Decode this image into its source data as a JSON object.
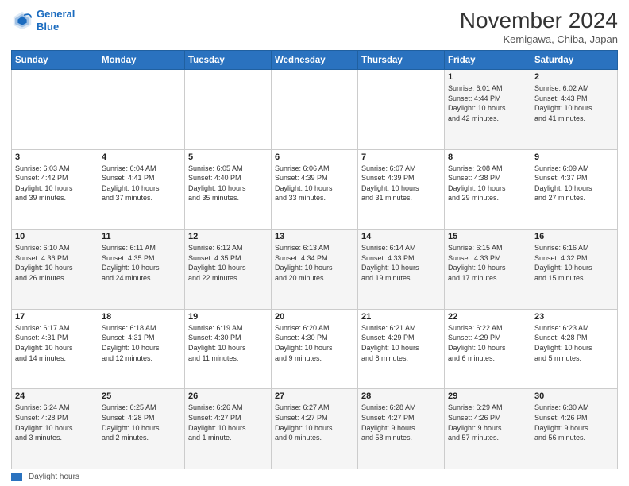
{
  "header": {
    "logo_line1": "General",
    "logo_line2": "Blue",
    "month_title": "November 2024",
    "location": "Kemigawa, Chiba, Japan"
  },
  "days_of_week": [
    "Sunday",
    "Monday",
    "Tuesday",
    "Wednesday",
    "Thursday",
    "Friday",
    "Saturday"
  ],
  "weeks": [
    [
      {
        "day": "",
        "info": ""
      },
      {
        "day": "",
        "info": ""
      },
      {
        "day": "",
        "info": ""
      },
      {
        "day": "",
        "info": ""
      },
      {
        "day": "",
        "info": ""
      },
      {
        "day": "1",
        "info": "Sunrise: 6:01 AM\nSunset: 4:44 PM\nDaylight: 10 hours\nand 42 minutes."
      },
      {
        "day": "2",
        "info": "Sunrise: 6:02 AM\nSunset: 4:43 PM\nDaylight: 10 hours\nand 41 minutes."
      }
    ],
    [
      {
        "day": "3",
        "info": "Sunrise: 6:03 AM\nSunset: 4:42 PM\nDaylight: 10 hours\nand 39 minutes."
      },
      {
        "day": "4",
        "info": "Sunrise: 6:04 AM\nSunset: 4:41 PM\nDaylight: 10 hours\nand 37 minutes."
      },
      {
        "day": "5",
        "info": "Sunrise: 6:05 AM\nSunset: 4:40 PM\nDaylight: 10 hours\nand 35 minutes."
      },
      {
        "day": "6",
        "info": "Sunrise: 6:06 AM\nSunset: 4:39 PM\nDaylight: 10 hours\nand 33 minutes."
      },
      {
        "day": "7",
        "info": "Sunrise: 6:07 AM\nSunset: 4:39 PM\nDaylight: 10 hours\nand 31 minutes."
      },
      {
        "day": "8",
        "info": "Sunrise: 6:08 AM\nSunset: 4:38 PM\nDaylight: 10 hours\nand 29 minutes."
      },
      {
        "day": "9",
        "info": "Sunrise: 6:09 AM\nSunset: 4:37 PM\nDaylight: 10 hours\nand 27 minutes."
      }
    ],
    [
      {
        "day": "10",
        "info": "Sunrise: 6:10 AM\nSunset: 4:36 PM\nDaylight: 10 hours\nand 26 minutes."
      },
      {
        "day": "11",
        "info": "Sunrise: 6:11 AM\nSunset: 4:35 PM\nDaylight: 10 hours\nand 24 minutes."
      },
      {
        "day": "12",
        "info": "Sunrise: 6:12 AM\nSunset: 4:35 PM\nDaylight: 10 hours\nand 22 minutes."
      },
      {
        "day": "13",
        "info": "Sunrise: 6:13 AM\nSunset: 4:34 PM\nDaylight: 10 hours\nand 20 minutes."
      },
      {
        "day": "14",
        "info": "Sunrise: 6:14 AM\nSunset: 4:33 PM\nDaylight: 10 hours\nand 19 minutes."
      },
      {
        "day": "15",
        "info": "Sunrise: 6:15 AM\nSunset: 4:33 PM\nDaylight: 10 hours\nand 17 minutes."
      },
      {
        "day": "16",
        "info": "Sunrise: 6:16 AM\nSunset: 4:32 PM\nDaylight: 10 hours\nand 15 minutes."
      }
    ],
    [
      {
        "day": "17",
        "info": "Sunrise: 6:17 AM\nSunset: 4:31 PM\nDaylight: 10 hours\nand 14 minutes."
      },
      {
        "day": "18",
        "info": "Sunrise: 6:18 AM\nSunset: 4:31 PM\nDaylight: 10 hours\nand 12 minutes."
      },
      {
        "day": "19",
        "info": "Sunrise: 6:19 AM\nSunset: 4:30 PM\nDaylight: 10 hours\nand 11 minutes."
      },
      {
        "day": "20",
        "info": "Sunrise: 6:20 AM\nSunset: 4:30 PM\nDaylight: 10 hours\nand 9 minutes."
      },
      {
        "day": "21",
        "info": "Sunrise: 6:21 AM\nSunset: 4:29 PM\nDaylight: 10 hours\nand 8 minutes."
      },
      {
        "day": "22",
        "info": "Sunrise: 6:22 AM\nSunset: 4:29 PM\nDaylight: 10 hours\nand 6 minutes."
      },
      {
        "day": "23",
        "info": "Sunrise: 6:23 AM\nSunset: 4:28 PM\nDaylight: 10 hours\nand 5 minutes."
      }
    ],
    [
      {
        "day": "24",
        "info": "Sunrise: 6:24 AM\nSunset: 4:28 PM\nDaylight: 10 hours\nand 3 minutes."
      },
      {
        "day": "25",
        "info": "Sunrise: 6:25 AM\nSunset: 4:28 PM\nDaylight: 10 hours\nand 2 minutes."
      },
      {
        "day": "26",
        "info": "Sunrise: 6:26 AM\nSunset: 4:27 PM\nDaylight: 10 hours\nand 1 minute."
      },
      {
        "day": "27",
        "info": "Sunrise: 6:27 AM\nSunset: 4:27 PM\nDaylight: 10 hours\nand 0 minutes."
      },
      {
        "day": "28",
        "info": "Sunrise: 6:28 AM\nSunset: 4:27 PM\nDaylight: 9 hours\nand 58 minutes."
      },
      {
        "day": "29",
        "info": "Sunrise: 6:29 AM\nSunset: 4:26 PM\nDaylight: 9 hours\nand 57 minutes."
      },
      {
        "day": "30",
        "info": "Sunrise: 6:30 AM\nSunset: 4:26 PM\nDaylight: 9 hours\nand 56 minutes."
      }
    ]
  ],
  "legend": {
    "label": "Daylight hours"
  }
}
